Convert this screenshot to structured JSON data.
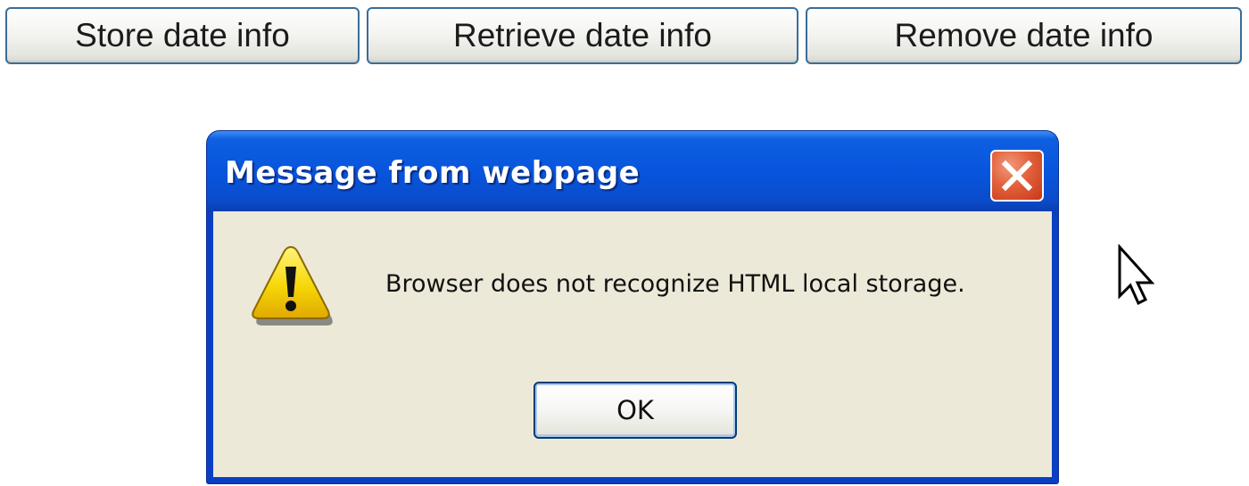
{
  "page": {
    "buttons": {
      "store": "Store date info",
      "retrieve": "Retrieve date info",
      "remove": "Remove date info"
    }
  },
  "dialog": {
    "title": "Message from webpage",
    "message": "Browser does not recognize HTML local storage.",
    "ok_label": "OK",
    "icon": "warning-icon",
    "close_icon": "close-icon"
  },
  "cursor": "arrow-cursor-icon",
  "colors": {
    "titlebar": "#0855dd",
    "dialog_body": "#ece9d8",
    "close_button": "#e2603a",
    "warning_yellow": "#f7d708"
  }
}
